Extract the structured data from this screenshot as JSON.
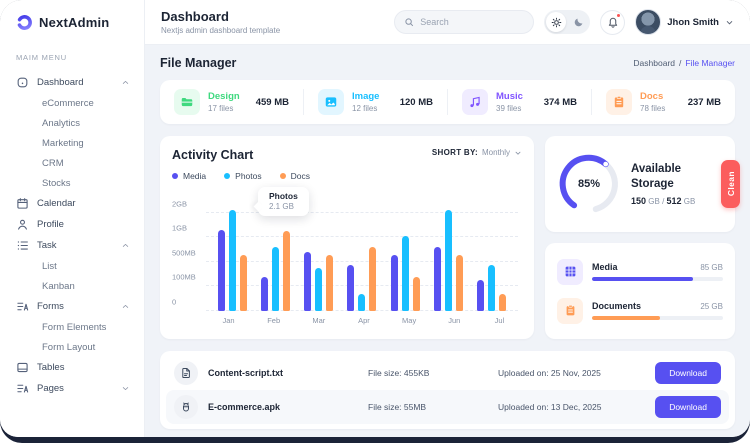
{
  "colors": {
    "primary": "#5750f1",
    "cyan": "#18bfff",
    "orange": "#ff9c55",
    "green": "#3fd97f",
    "red": "#fb5d5d",
    "dark": "#1c2434",
    "frame": "#1b2338"
  },
  "sidebar": {
    "logo": "NextAdmin",
    "menu_label": "MAIM MENU",
    "items": [
      {
        "label": "Dashboard",
        "icon": "dashboard-icon",
        "chevron": "up",
        "children": [
          "eCommerce",
          "Analytics",
          "Marketing",
          "CRM",
          "Stocks"
        ]
      },
      {
        "label": "Calendar",
        "icon": "calendar-icon"
      },
      {
        "label": "Profile",
        "icon": "profile-icon"
      },
      {
        "label": "Task",
        "icon": "task-icon",
        "chevron": "up",
        "children": [
          "List",
          "Kanban"
        ]
      },
      {
        "label": "Forms",
        "icon": "forms-icon",
        "chevron": "up",
        "children": [
          "Form Elements",
          "Form Layout"
        ]
      },
      {
        "label": "Tables",
        "icon": "tables-icon"
      },
      {
        "label": "Pages",
        "icon": "pages-icon",
        "chevron": "down"
      }
    ]
  },
  "header": {
    "title": "Dashboard",
    "subtitle": "Nextjs admin dashboard template",
    "search_placeholder": "Search",
    "user_name": "Jhon Smith"
  },
  "page": {
    "title": "File Manager",
    "breadcrumb": {
      "home": "Dashboard",
      "sep": "/",
      "current": "File Manager"
    }
  },
  "stats": [
    {
      "name": "Design",
      "files": "17 files",
      "size": "459 MB",
      "icon": "folder-icon",
      "color": "#3fd97f",
      "bg": "#e7fbef"
    },
    {
      "name": "Image",
      "files": "12 files",
      "size": "120 MB",
      "icon": "image-icon",
      "color": "#18bfff",
      "bg": "#e2f6ff"
    },
    {
      "name": "Music",
      "files": "39 files",
      "size": "374 MB",
      "icon": "music-icon",
      "color": "#8155ff",
      "bg": "#f0ecff"
    },
    {
      "name": "Docs",
      "files": "78 files",
      "size": "237 MB",
      "icon": "docs-icon",
      "color": "#ff9c55",
      "bg": "#fff1e6"
    }
  ],
  "chart_data": {
    "type": "bar",
    "title": "Activity Chart",
    "sort_label": "SHORT BY:",
    "sort_value": "Monthly",
    "categories": [
      "Jan",
      "Feb",
      "Mar",
      "Apr",
      "May",
      "Jun",
      "Jul"
    ],
    "unit": "MB",
    "ylim": [
      0,
      2000
    ],
    "yticks": [
      {
        "label": "0",
        "mb": 0
      },
      {
        "label": "100MB",
        "mb": 100
      },
      {
        "label": "500MB",
        "mb": 500
      },
      {
        "label": "1GB",
        "mb": 1000
      },
      {
        "label": "2GB",
        "mb": 2000
      }
    ],
    "grid": "dashed-horizontal",
    "legend_position": "top-left",
    "series": [
      {
        "name": "Media",
        "color": "#5750f1",
        "values": [
          1300,
          250,
          700,
          450,
          650,
          800,
          200
        ]
      },
      {
        "name": "Photos",
        "color": "#18bfff",
        "values": [
          2100,
          800,
          400,
          70,
          1050,
          2100,
          450
        ]
      },
      {
        "name": "Docs",
        "color": "#ff9c55",
        "values": [
          650,
          1250,
          650,
          800,
          250,
          650,
          70
        ]
      }
    ],
    "tooltip": {
      "series": "Photos",
      "category": "Jan",
      "value": "2.1 GB"
    }
  },
  "storage": {
    "percent": "85%",
    "title": "Available Storage",
    "used": "150",
    "used_unit": "GB",
    "sep": "/",
    "total": "512",
    "total_unit": "GB",
    "clean_label": "Clean"
  },
  "usage": [
    {
      "label": "Media",
      "value": "85 GB",
      "pct": 77,
      "color": "#5750f1",
      "icon": "media-grid-icon",
      "bg": "#f0ecff",
      "icon_color": "#5750f1"
    },
    {
      "label": "Documents",
      "value": "25 GB",
      "pct": 52,
      "color": "#ff9c55",
      "icon": "documents-icon",
      "bg": "#fff1e6",
      "icon_color": "#ff9c55"
    }
  ],
  "files": [
    {
      "name": "Content-script.txt",
      "icon": "file-text-icon",
      "size": "File size: 455KB",
      "uploaded": "Uploaded on: 25 Nov, 2025",
      "action": "Download"
    },
    {
      "name": "E-commerce.apk",
      "icon": "android-icon",
      "size": "File size: 55MB",
      "uploaded": "Uploaded on: 13 Dec, 2025",
      "action": "Download"
    }
  ]
}
